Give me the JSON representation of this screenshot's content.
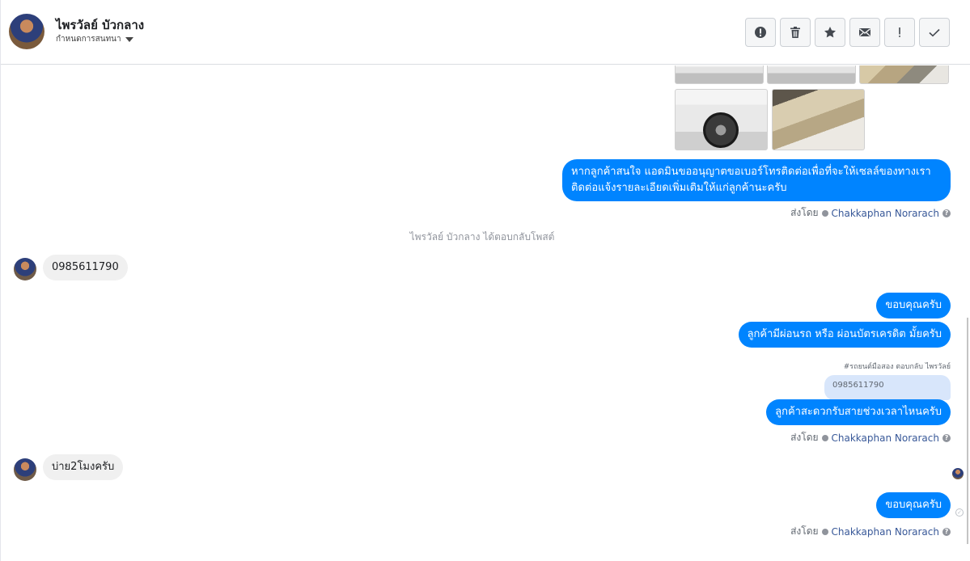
{
  "header": {
    "contact_name": "ไพรวัลย์ บัวกลาง",
    "assign_label": "กำหนดการสนทนา",
    "actions": [
      {
        "name": "report-spam",
        "icon": "alert-circle-icon"
      },
      {
        "name": "delete",
        "icon": "trash-icon"
      },
      {
        "name": "star",
        "icon": "star-icon"
      },
      {
        "name": "mark-unread",
        "icon": "envelope-icon"
      },
      {
        "name": "mark-important",
        "icon": "exclamation-icon"
      },
      {
        "name": "mark-done",
        "icon": "check-icon"
      }
    ]
  },
  "messages": {
    "outgoing_1": "หากลูกค้าสนใจ แอดมินขออนุญาตขอเบอร์โทรติดต่อเพื่อที่จะให้เซลล์ของทางเรา ติดต่อแจ้งรายละเอียดเพิ่มเติมให้แก่ลูกค้านะครับ",
    "sent_by_label": "ส่งโดย",
    "agent_name": "Chakkaphan Norarach",
    "system_note": "ไพรวัลย์ บัวกลาง ได้ตอบกลับโพสต์",
    "incoming_1": "0985611790",
    "outgoing_2": "ขอบคุณครับ",
    "outgoing_3": "ลูกค้ามีผ่อนรถ หรือ ผ่อนบัตรเครดิต มั้ยครับ",
    "reply_hint": "#รถยนต์มือสอง ตอบกลับ ไพรวัลย์",
    "quoted_text": "0985611790",
    "outgoing_4": "ลูกค้าสะดวกรับสายช่วงเวลาไหนครับ",
    "incoming_2": "บ่าย2โมงครับ",
    "outgoing_5": "ขอบคุณครับ"
  },
  "colors": {
    "outgoing_bubble": "#0084ff",
    "incoming_bubble": "#f0f0f0",
    "agent_link": "#385898"
  }
}
